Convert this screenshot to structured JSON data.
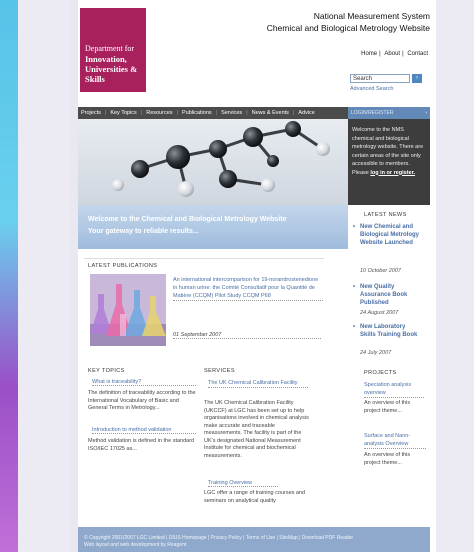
{
  "branding": {
    "logo_line1": "Department for",
    "logo_line2": "Innovation,",
    "logo_line3": "Universities &",
    "logo_line4": "Skills",
    "logo_color": "#a8215c"
  },
  "header": {
    "title_line1": "National Measurement System",
    "title_line2": "Chemical and Biological Metrology Website"
  },
  "util_nav": [
    "Home",
    "About",
    "Contact"
  ],
  "search": {
    "value": "Search",
    "button_label": "Go",
    "advanced_label": "Advanced Search"
  },
  "nav": {
    "items": [
      "Projects",
      "Key Topics",
      "Resources",
      "Publications",
      "Services",
      "News & Events",
      "Advice"
    ]
  },
  "login": {
    "bar_label": "LOGIN/REGISTER",
    "text": "Welcome to the NMS chemical and biological metrology website. There are certain areas of the site only accessible to members. Please",
    "link": "log in or register."
  },
  "hero": {
    "line1": "Welcome to the Chemical and Biological Metrology Website",
    "line2": "Your gateway to reliable results..."
  },
  "publications": {
    "heading": "LATEST PUBLICATIONS",
    "title": "An international intercomparison for 19-norandrostenedione in human urine: the Comité Consultatif pour la Quantité de Matière (CCQM) Pilot Study CCQM P68",
    "date": "01 September 2007"
  },
  "key_topics": {
    "heading": "KEY TOPICS",
    "link1": "What is traceability?",
    "text1": "The definition of traceability according to the International Vocabulary of Basic and General Terms in Metrology...",
    "link2": "Introduction to method validation",
    "text2": "Method validation is defined in the standard ISO/IEC 17025 as..."
  },
  "services": {
    "heading": "SERVICES",
    "link1": "The UK Chemical Calibration Facility",
    "text1": "The UK Chemical Calibration Facility (UKCCF) at LGC has been set up to help organisations involved in chemical analysis make accurate and traceable measurements. The facility is part of the UK's designated National Measurement Institute for chemical and biochemical measurements.",
    "link2": "Training Overview",
    "text2": "LGC offer a range of training courses and seminars on analytical quality"
  },
  "news": {
    "heading": "LATEST NEWS",
    "items": [
      {
        "title": "New Chemical and Biological Metrology Website Launched",
        "date": "10 October 2007"
      },
      {
        "title": "New Quality Assurance Book Published",
        "date": "24 August 2007"
      },
      {
        "title": "New Laboratory Skills Training Book",
        "date": "24 July 2007"
      }
    ]
  },
  "projects": {
    "heading": "PROJECTS",
    "link1": "Speciation analysis overview",
    "text1": "An overview of this project theme...",
    "link2": "Surface and Nano-analysis Overview",
    "text2": "An overview of this project theme..."
  },
  "footer": {
    "line1": "© Copyright 2001/2007 LGC Limited | DIUS Homepage | Privacy Policy | Terms of Use | SiteMap | Download PDF Reader",
    "line2": "Web layout and web development by Reagent"
  }
}
